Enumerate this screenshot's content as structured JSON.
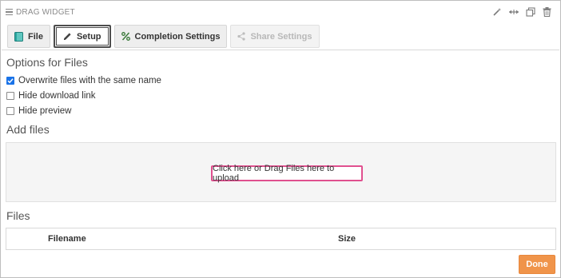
{
  "widget": {
    "title": "DRAG WIDGET"
  },
  "toolbar": {
    "icons": [
      "magic-wand-icon",
      "resize-icon",
      "copy-icon",
      "trash-icon"
    ]
  },
  "tabs": [
    {
      "label": "File",
      "icon": "file-icon",
      "state": "normal"
    },
    {
      "label": "Setup",
      "icon": "pencil-icon",
      "state": "active"
    },
    {
      "label": "Completion Settings",
      "icon": "percent-icon",
      "state": "normal"
    },
    {
      "label": "Share Settings",
      "icon": "share-icon",
      "state": "disabled"
    }
  ],
  "options": {
    "title": "Options for Files",
    "items": [
      {
        "label": "Overwrite files with the same name",
        "checked": true
      },
      {
        "label": "Hide download link",
        "checked": false
      },
      {
        "label": "Hide preview",
        "checked": false
      }
    ]
  },
  "add_files": {
    "title": "Add files",
    "upload_label": "Click here or Drag Files here to upload"
  },
  "files": {
    "title": "Files",
    "columns": [
      "Filename",
      "Size"
    ]
  },
  "actions": {
    "done_label": "Done"
  },
  "colors": {
    "accent": "#1a73e8",
    "upload_border": "#e0508f",
    "done_button": "#f0944a"
  }
}
